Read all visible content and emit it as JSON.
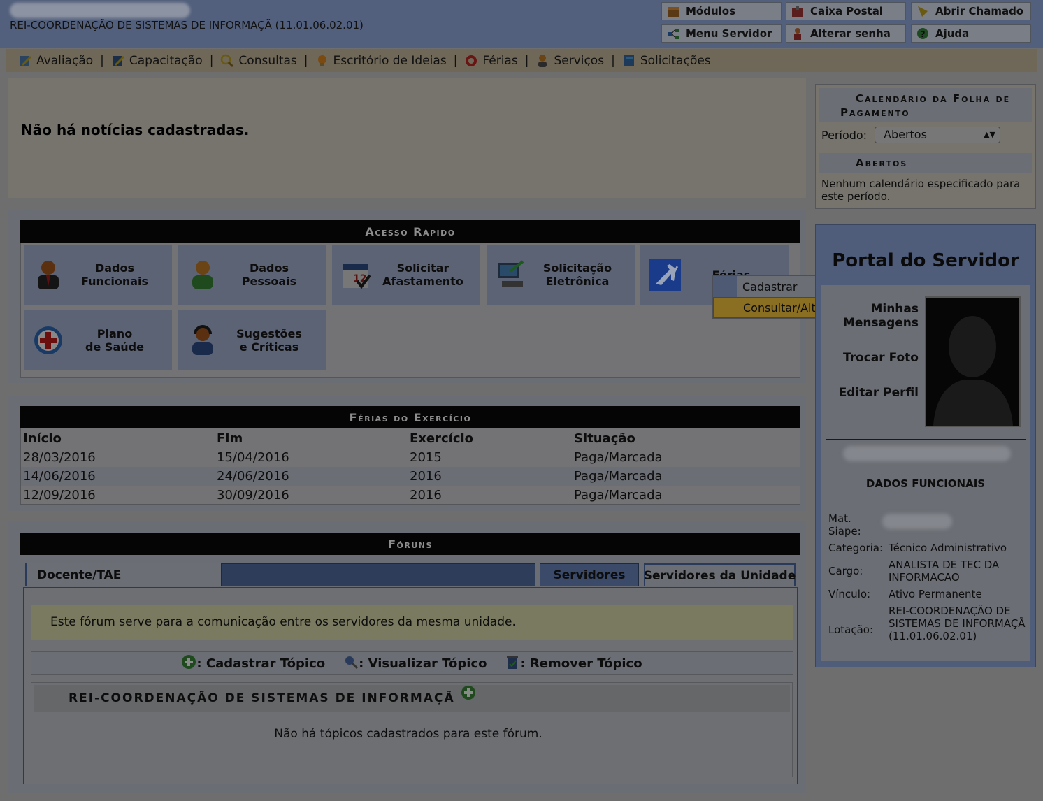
{
  "header": {
    "unit_title": "REI-COORDENAÇÃO DE SISTEMAS DE INFORMAÇÃ (11.01.06.02.01)",
    "buttons": [
      {
        "label": "Módulos",
        "icon": "modules-icon"
      },
      {
        "label": "Caixa Postal",
        "icon": "mailbox-icon"
      },
      {
        "label": "Abrir Chamado",
        "icon": "ticket-icon"
      },
      {
        "label": "Menu Servidor",
        "icon": "menu-icon"
      },
      {
        "label": "Alterar senha",
        "icon": "user-key-icon"
      },
      {
        "label": "Ajuda",
        "icon": "help-icon"
      }
    ]
  },
  "menubar": {
    "items": [
      {
        "label": "Avaliação",
        "icon": "evaluation-icon"
      },
      {
        "label": "Capacitação",
        "icon": "training-icon"
      },
      {
        "label": "Consultas",
        "icon": "search-icon"
      },
      {
        "label": "Escritório de Ideias",
        "icon": "lightbulb-icon"
      },
      {
        "label": "Férias",
        "icon": "lifebuoy-icon"
      },
      {
        "label": "Serviços",
        "icon": "person-icon"
      },
      {
        "label": "Solicitações",
        "icon": "book-icon"
      }
    ],
    "separator": "|"
  },
  "news": {
    "text": "Não há notícias cadastradas."
  },
  "quick_access": {
    "title": "Acesso Rápido",
    "tiles": [
      {
        "label": "Dados\nFuncionais",
        "icon": "business-person-icon"
      },
      {
        "label": "Dados\nPessoais",
        "icon": "person-icon"
      },
      {
        "label": "Solicitar\nAfastamento",
        "icon": "calendar-icon"
      },
      {
        "label": "Solicitação\nEletrônica",
        "icon": "computer-icon"
      },
      {
        "label": "Férias",
        "icon": "airplane-icon"
      },
      {
        "label": "Plano\nde Saúde",
        "icon": "health-cross-icon"
      },
      {
        "label": "Sugestões\ne Críticas",
        "icon": "support-agent-icon"
      }
    ],
    "ferias_menu": {
      "items": [
        "Cadastrar",
        "Consultar/Alterar"
      ],
      "active_index": 1
    }
  },
  "ferias_exercicio": {
    "title": "Férias do Exercício",
    "columns": [
      "Início",
      "Fim",
      "Exercício",
      "Situação"
    ],
    "rows": [
      [
        "28/03/2016",
        "15/04/2016",
        "2015",
        "Paga/Marcada"
      ],
      [
        "14/06/2016",
        "24/06/2016",
        "2016",
        "Paga/Marcada"
      ],
      [
        "12/09/2016",
        "30/09/2016",
        "2016",
        "Paga/Marcada"
      ]
    ]
  },
  "foruns": {
    "title": "Fóruns",
    "tabs": [
      "Docente/TAE",
      "Servidores",
      "Servidores da Unidade"
    ],
    "active_tab": "Servidores da Unidade",
    "info": "Este fórum serve para a comunicação entre os servidores da mesma unidade.",
    "legend": [
      {
        "label": ": Cadastrar Tópico",
        "icon": "add-icon"
      },
      {
        "label": ": Visualizar Tópico",
        "icon": "magnifier-icon"
      },
      {
        "label": ": Remover Tópico",
        "icon": "trash-icon"
      }
    ],
    "forum_name": "REI-COORDENAÇÃO DE SISTEMAS DE INFORMAÇÃ",
    "empty_text": "Não há tópicos cadastrados para este fórum."
  },
  "calendario": {
    "title_line1": "Calendário da Folha de",
    "title_line2": "Pagamento",
    "periodo_label": "Período:",
    "periodo_value": "Abertos",
    "section": "Abertos",
    "empty_text": "Nenhum calendário especificado para este período."
  },
  "portal": {
    "title": "Portal do Servidor",
    "links": [
      "Minhas\nMensagens",
      "Trocar Foto",
      "Editar Perfil"
    ],
    "dados_title": "DADOS FUNCIONAIS",
    "fields": [
      {
        "label": "Mat.\nSiape:",
        "value": ""
      },
      {
        "label": "Categoria:",
        "value": "Técnico Administrativo"
      },
      {
        "label": "Cargo:",
        "value": "ANALISTA DE TEC DA INFORMACAO"
      },
      {
        "label": "Vínculo:",
        "value": "Ativo Permanente"
      },
      {
        "label": "Lotação:",
        "value": "REI-COORDENAÇÃO DE SISTEMAS DE INFORMAÇÃ (11.01.06.02.01)"
      }
    ]
  },
  "colors": {
    "overlay_bg": "#6e6e6e",
    "header": "#52607d",
    "section_title_bg": "#050505",
    "active_menu": "#8a6f22"
  }
}
